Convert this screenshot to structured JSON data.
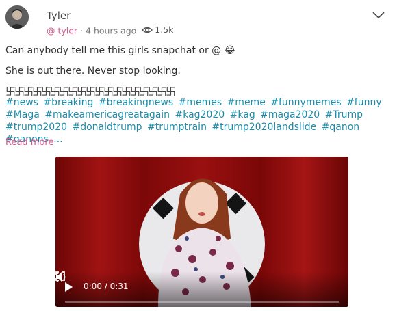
{
  "post": {
    "username": "Tyler",
    "handle": "@ tyler",
    "time_ago": "4 hours ago",
    "views": "1.5k",
    "line1": "Can anybody tell me this girls snapchat or @ 😂",
    "line2": "She is out there. Never stop looking.",
    "symbol_row": "卐卐卐卐卐卐卐卐卐卐卐卐卐卐卐卐卐卐卐",
    "hashtags": [
      "#news",
      "#breaking",
      "#breakingnews",
      "#memes",
      "#meme",
      "#funnymemes",
      "#funny",
      "#Maga",
      "#makeamericagreatagain",
      "#kag2020",
      "#kag",
      "#maga2020",
      "#Trump",
      "#trump2020",
      "#donaldtrump",
      "#trumptrain",
      "#trump2020landslide",
      "#qanon",
      "#qanons",
      "..."
    ],
    "read_more": "Read more"
  },
  "video": {
    "time": "0:00 / 0:31",
    "progress": 0.0
  },
  "colors": {
    "accent_pink": "#d4558a",
    "hashtag_blue": "#1b8ca9",
    "video_red": "#8b0a0a"
  },
  "icons": [
    "avatar",
    "eye-icon",
    "chevron-down-icon",
    "play-icon",
    "volume-icon",
    "fullscreen-icon",
    "more-vert-icon"
  ]
}
